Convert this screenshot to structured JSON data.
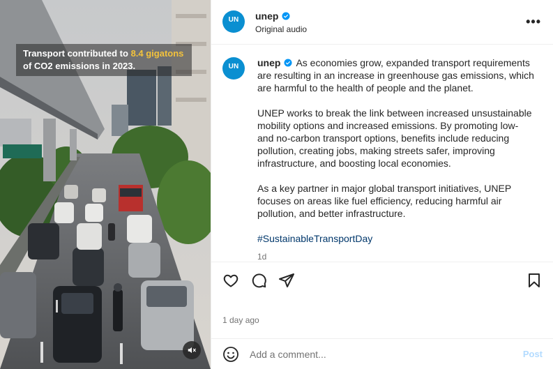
{
  "media": {
    "caption_prefix": "Transport contributed to ",
    "caption_highlight": "8.4 gigatons",
    "caption_suffix": " of CO2 emissions in 2023.",
    "highlight_color": "#f3c23c",
    "mute_icon": "muted-speaker-icon"
  },
  "header": {
    "avatar_text": "UN",
    "username": "unep",
    "audio": "Original audio",
    "more": "•••"
  },
  "post": {
    "username": "unep",
    "para1": "As economies grow, expanded transport requirements are resulting in an increase in greenhouse gas emissions, which are harmful to the health of people and the planet.",
    "para2": "UNEP works to break the link between increased unsustainable mobility options and increased emissions. By promoting low- and no-carbon transport options, benefits include reducing pollution, creating jobs, making streets safer, improving infrastructure, and boosting local economies.",
    "para3": "As a key partner in major global transport initiatives, UNEP focuses on areas like fuel efficiency, reducing harmful air pollution, and better infrastructure.",
    "hashtag": "#SustainableTransportDay",
    "timestamp": "1d"
  },
  "actions": {
    "icons": [
      "heart-icon",
      "comment-icon",
      "share-icon",
      "bookmark-icon"
    ]
  },
  "date": "1 day ago",
  "comment": {
    "placeholder": "Add a comment...",
    "post_label": "Post"
  },
  "colors": {
    "brand": "#0a8fd1",
    "verified": "#0095f6",
    "hashtag": "#00376b",
    "post_disabled": "#b3dbff"
  }
}
